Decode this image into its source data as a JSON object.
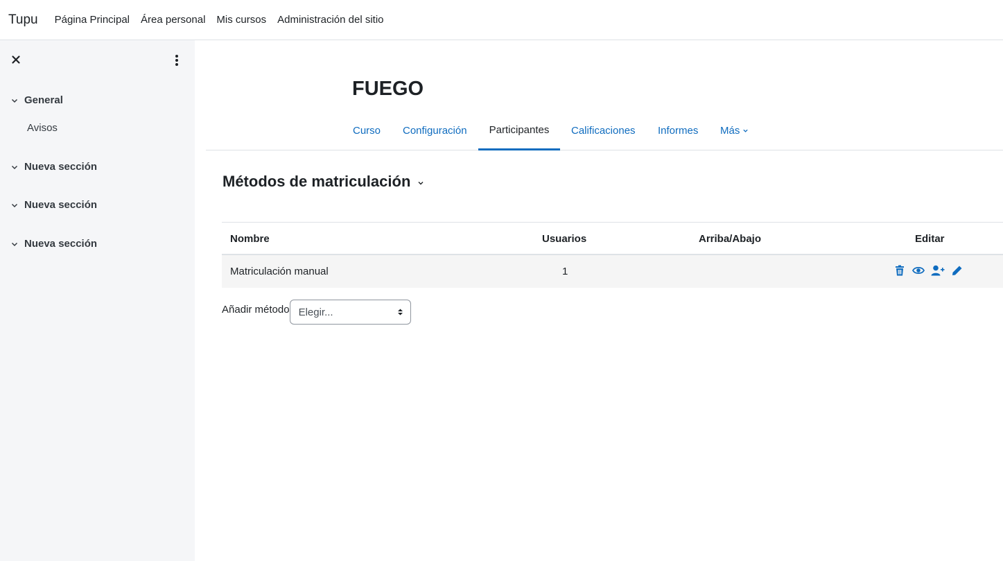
{
  "navbar": {
    "brand": "Tupu",
    "items": [
      "Página Principal",
      "Área personal",
      "Mis cursos",
      "Administración del sitio"
    ]
  },
  "drawer": {
    "close_icon": "close-icon",
    "more_icon": "kebab-icon",
    "sections": [
      {
        "label": "General"
      },
      {
        "label": "Nueva sección"
      },
      {
        "label": "Nueva sección"
      },
      {
        "label": "Nueva sección"
      }
    ],
    "activity": "Avisos"
  },
  "course": {
    "title": "FUEGO"
  },
  "tabs": [
    {
      "label": "Curso"
    },
    {
      "label": "Configuración"
    },
    {
      "label": "Participantes",
      "active": true
    },
    {
      "label": "Calificaciones"
    },
    {
      "label": "Informes"
    },
    {
      "label": "Más"
    }
  ],
  "page": {
    "heading": "Métodos de matriculación"
  },
  "table": {
    "headers": [
      "Nombre",
      "Usuarios",
      "Arriba/Abajo",
      "Editar"
    ],
    "rows": [
      {
        "name": "Matriculación manual",
        "users": "1",
        "actions": [
          "trash-icon",
          "eye-icon",
          "user-plus-icon",
          "pencil-icon"
        ]
      }
    ]
  },
  "add_method": {
    "label": "Añadir método",
    "select_value": "Elegir..."
  },
  "colors": {
    "accent": "#0f6cbf",
    "drawer_bg": "#f5f6f8",
    "row_bg": "#f5f5f5"
  }
}
